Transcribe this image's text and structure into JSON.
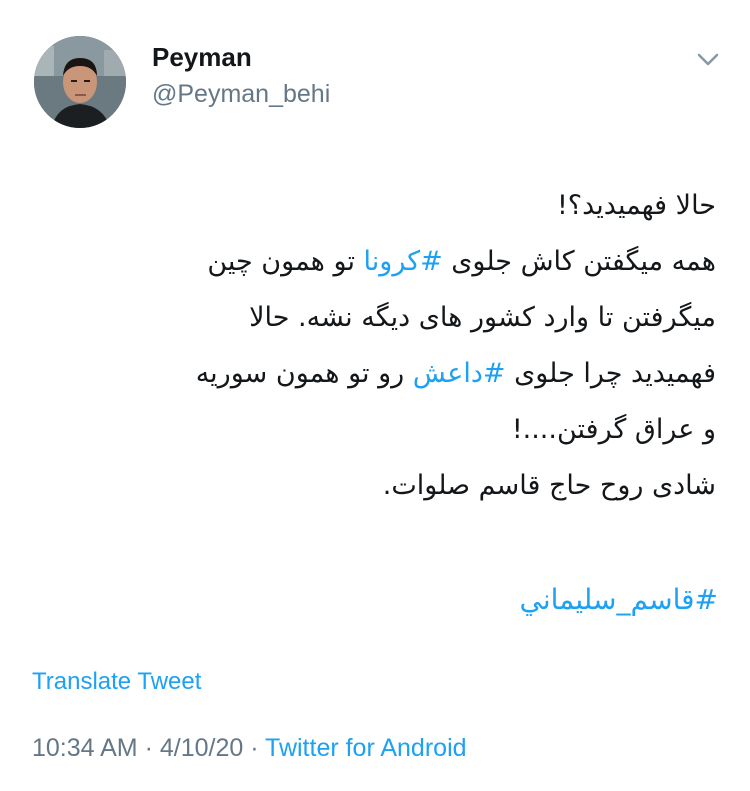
{
  "user": {
    "display_name": "Peyman",
    "handle": "@Peyman_behi"
  },
  "icons": {
    "menu": "chevron-down-icon",
    "avatar": "profile-photo"
  },
  "colors": {
    "link": "#1da1f2",
    "secondary_text": "#657786",
    "primary_text": "#14171a"
  },
  "tweet": {
    "lines": [
      {
        "before": "حالا فهمیدید؟!",
        "hashtag": "",
        "after": ""
      },
      {
        "before": "همه میگفتن کاش جلوی ",
        "hashtag": "#کرونا",
        "after": " تو همون چین"
      },
      {
        "before": "میگرفتن تا وارد  کشور های دیگه نشه. حالا",
        "hashtag": "",
        "after": ""
      },
      {
        "before": "فهمیدید چرا جلوی ",
        "hashtag": "#داعش",
        "after": " رو تو همون سوریه"
      },
      {
        "before": "و عراق گرفتن....!",
        "hashtag": "",
        "after": ""
      },
      {
        "before": "شادی روح حاج قاسم صلوات.",
        "hashtag": "",
        "after": ""
      }
    ],
    "hashtag_line": "#قاسم_سليماني"
  },
  "translate_label": "Translate Tweet",
  "meta": {
    "time": "10:34 AM",
    "separator1": " · ",
    "date": "4/10/20",
    "separator2": " · ",
    "source": "Twitter for Android"
  }
}
